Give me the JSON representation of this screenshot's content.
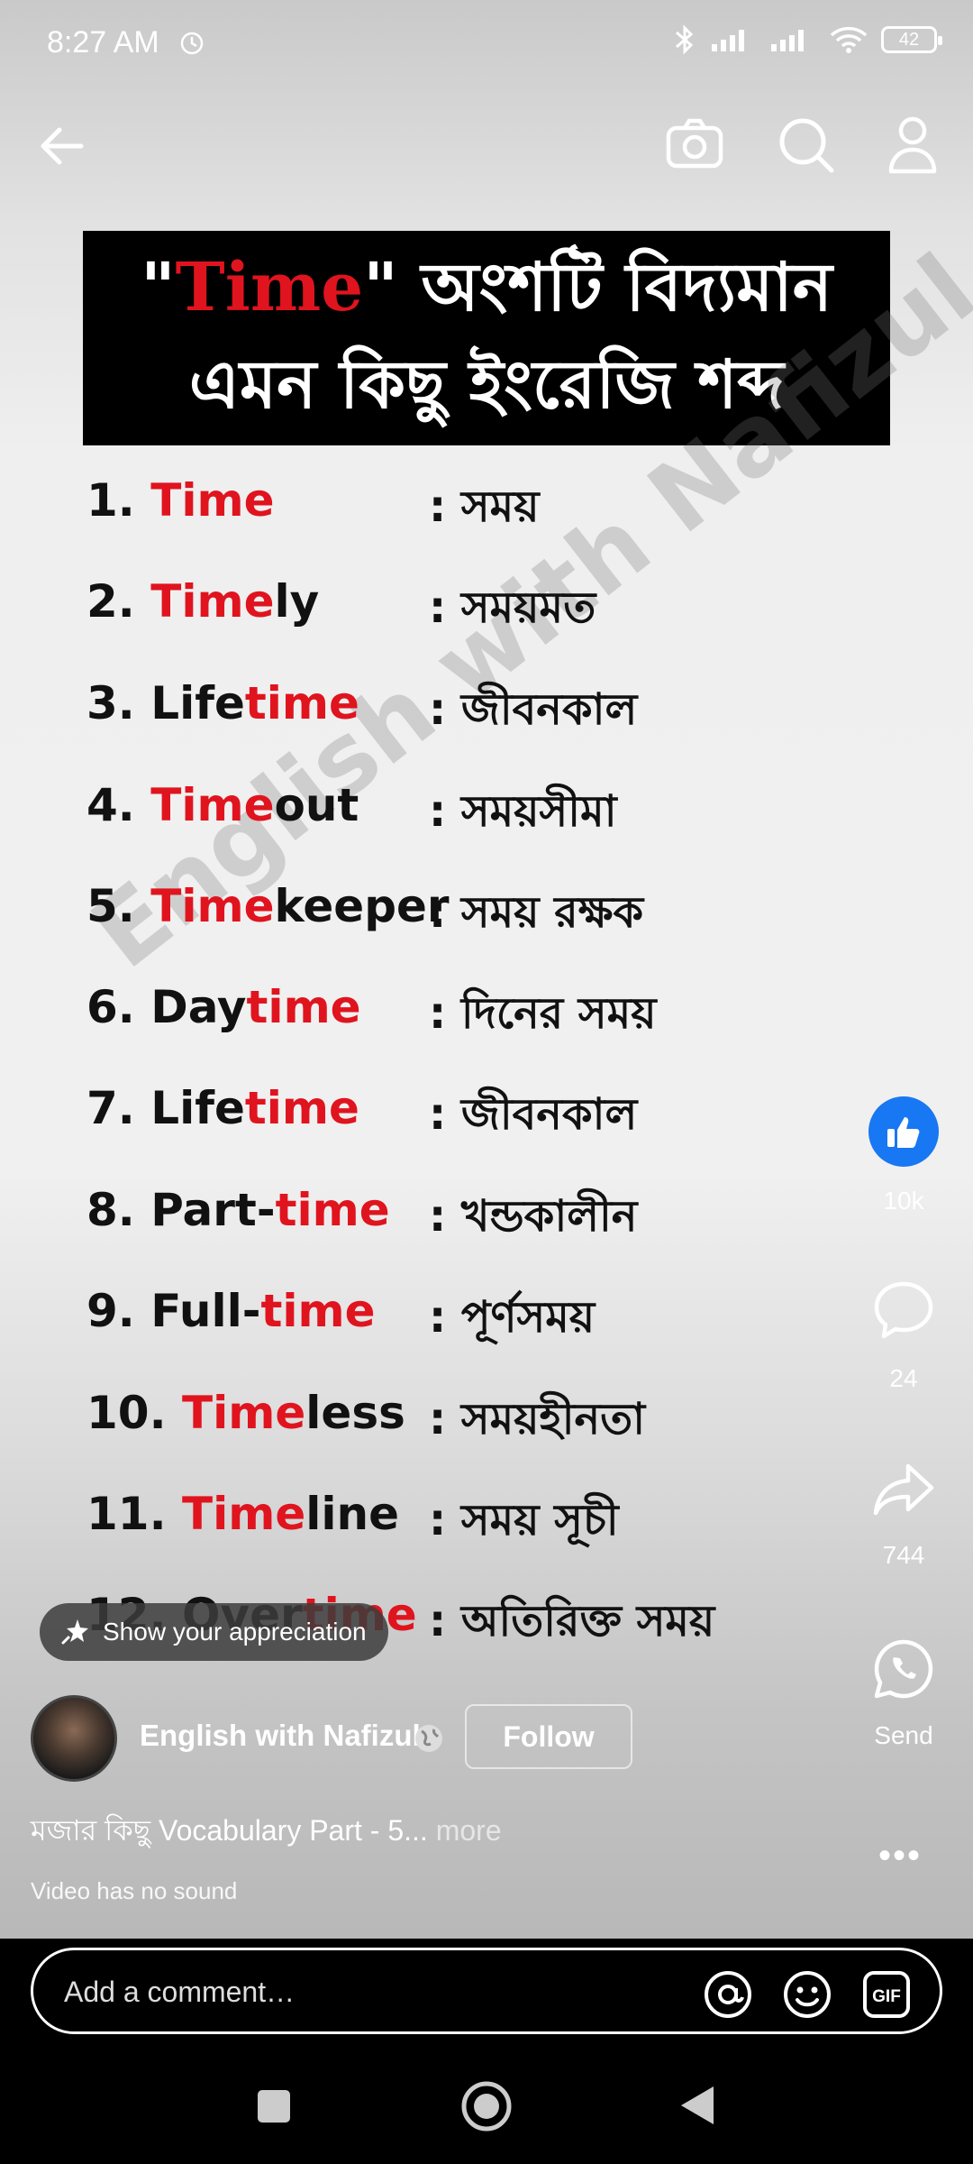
{
  "status_bar": {
    "time": "8:27 AM",
    "battery": "42"
  },
  "banner": {
    "quote_open": "\"",
    "highlight": "Time",
    "line1_rest": "\" অংশটি বিদ্যমান",
    "line2": "এমন কিছু ইংরেজি শব্দ"
  },
  "words": [
    {
      "num": "1.",
      "pre": "",
      "hi": "Time",
      "post": "",
      "meaning": ": সময়"
    },
    {
      "num": "2.",
      "pre": "",
      "hi": "Time",
      "post": "ly",
      "meaning": ": সময়মত"
    },
    {
      "num": "3.",
      "pre": "Life",
      "hi": "time",
      "post": "",
      "meaning": ": জীবনকাল"
    },
    {
      "num": "4.",
      "pre": "",
      "hi": "Time",
      "post": "out",
      "meaning": ": সময়সীমা"
    },
    {
      "num": "5.",
      "pre": "",
      "hi": "Time",
      "post": "keeper",
      "meaning": ": সময় রক্ষক"
    },
    {
      "num": "6.",
      "pre": "Day",
      "hi": "time",
      "post": "",
      "meaning": ": দিনের সময়"
    },
    {
      "num": "7.",
      "pre": "Life",
      "hi": "time",
      "post": "",
      "meaning": ": জীবনকাল"
    },
    {
      "num": "8.",
      "pre": "Part-",
      "hi": "time",
      "post": "",
      "meaning": ": খন্ডকালীন"
    },
    {
      "num": "9.",
      "pre": "Full-",
      "hi": "time",
      "post": "",
      "meaning": ": পূর্ণসময়"
    },
    {
      "num": "10.",
      "pre": "",
      "hi": "Time",
      "post": "less",
      "meaning": ": সময়হীনতা"
    },
    {
      "num": "11.",
      "pre": "",
      "hi": "Time",
      "post": "line",
      "meaning": ": সময় সূচী"
    },
    {
      "num": "12.",
      "pre": "Over",
      "hi": "time",
      "post": "",
      "meaning": ": অতিরিক্ত সময়"
    }
  ],
  "watermark": "English with Nafizul",
  "rail": {
    "likes": "10k",
    "comments": "24",
    "shares": "744",
    "send_label": "Send"
  },
  "appreciation_label": "Show your appreciation",
  "channel_name": "English with Nafizul",
  "follow_label": "Follow",
  "caption": "মজার কিছু Vocabulary Part - 5...",
  "caption_more": "more",
  "no_sound": "Video has no sound",
  "comment_placeholder": "Add a comment…",
  "icons": [
    "back-arrow-icon",
    "camera-icon",
    "search-icon",
    "profile-icon",
    "like-icon",
    "comment-icon",
    "share-icon",
    "whatsapp-icon",
    "more-icon",
    "mention-icon",
    "emoji-icon",
    "gif-icon"
  ]
}
